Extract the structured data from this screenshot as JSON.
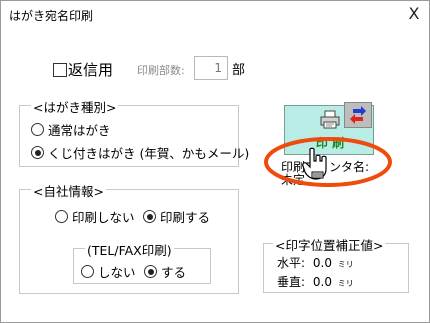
{
  "window": {
    "title": "はがき宛名印刷",
    "close_glyph": "X"
  },
  "top": {
    "reply_label": "返信用",
    "reply_checked": false,
    "copies_label": "印刷部数:",
    "copies_value": "1",
    "copies_unit": "部"
  },
  "card_type": {
    "legend": "<はがき種別>",
    "options": [
      {
        "label": "通常はがき",
        "selected": false
      },
      {
        "label": "くじ付きはがき (年賀、かもメール)",
        "selected": true
      }
    ]
  },
  "company": {
    "legend": "<自社情報>",
    "options": [
      {
        "label": "印刷しない",
        "selected": false
      },
      {
        "label": "印刷する",
        "selected": true
      }
    ],
    "tel_fax": {
      "legend": "(TEL/FAX印刷)",
      "options": [
        {
          "label": "しない",
          "selected": false
        },
        {
          "label": "する",
          "selected": true
        }
      ]
    }
  },
  "print": {
    "button_label": "印 刷",
    "printer_name_label": "印刷プリンタ名:",
    "printer_name_value": "未定",
    "icon": "printer-icon",
    "swap_icon": "swap-icon",
    "accent": "#b8ece4",
    "annotation_color": "#f04a0c"
  },
  "offset": {
    "legend": "<印字位置補正値>",
    "horizontal_label": "水平:",
    "horizontal_value": "0.0",
    "vertical_label": "垂直:",
    "vertical_value": "0.0",
    "unit": "ミリ"
  }
}
